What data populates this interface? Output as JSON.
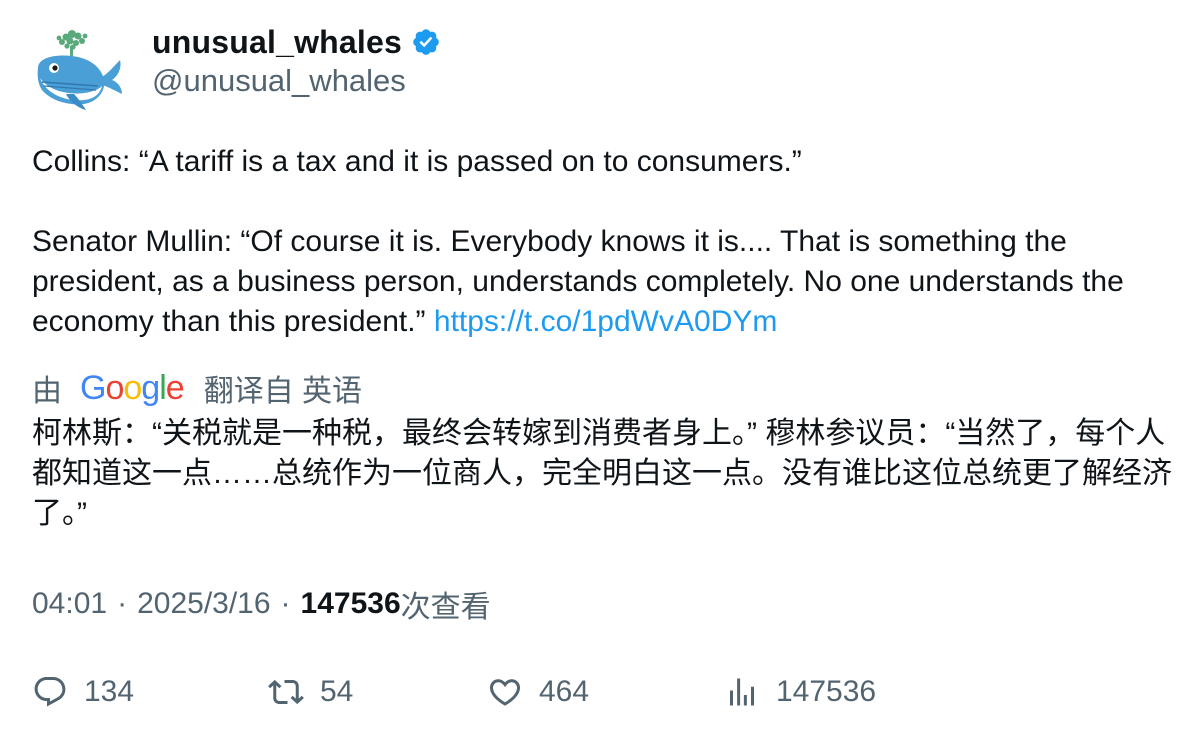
{
  "author": {
    "display_name": "unusual_whales",
    "handle": "@unusual_whales",
    "verified": true,
    "avatar_icon": "whale-icon",
    "verified_color": "#1d9bf0"
  },
  "tweet": {
    "paragraph1": "Collins: “A tariff is a tax and it is passed on to consumers.”",
    "paragraph2": "Senator Mullin: “Of course it is. Everybody knows it is.... That is something the president, as a business person, understands completely. No one understands the economy than this president.”",
    "link": "https://t.co/1pdWvA0DYm",
    "link_color": "#1d9bf0"
  },
  "translation": {
    "by_label": "由",
    "provider": "Google",
    "from_label": "翻译自 英语",
    "text": "柯林斯：“关税就是一种税，最终会转嫁到消费者身上。” 穆林参议员：“当然了，每个人都知道这一点……总统作为一位商人，完全明白这一点。没有谁比这位总统更了解经济了。”"
  },
  "meta": {
    "time": "04:01",
    "separator": "·",
    "date": "2025/3/16",
    "views_count": "147536",
    "views_label": "次查看"
  },
  "actions": {
    "replies": "134",
    "retweets": "54",
    "likes": "464",
    "views": "147536"
  }
}
